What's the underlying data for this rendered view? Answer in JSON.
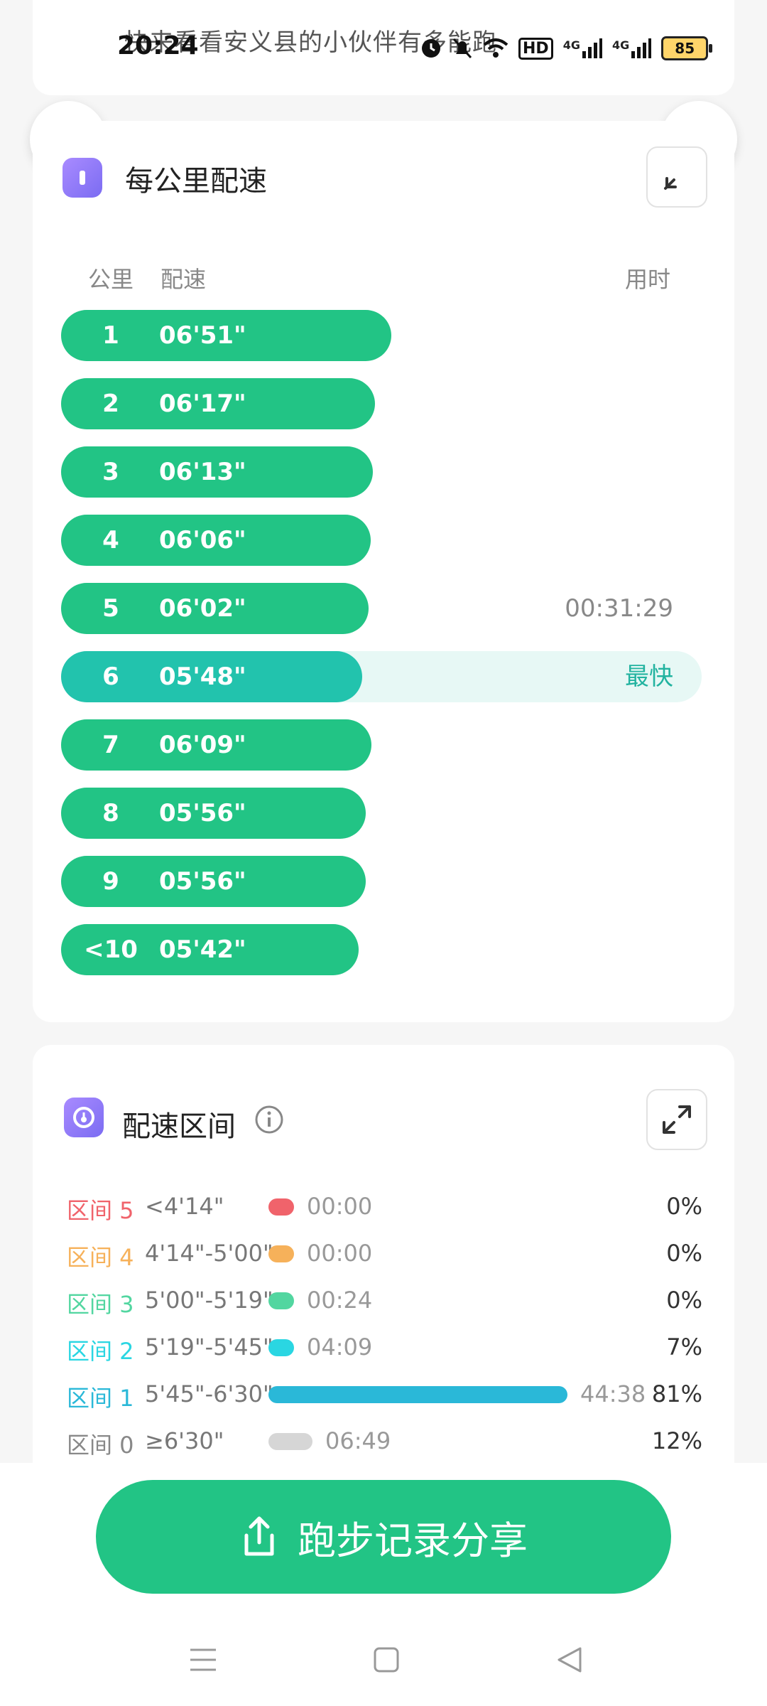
{
  "status_bar": {
    "title": "快来看看安义县的小伙伴有多能跑",
    "time": "20:24",
    "hd_label": "HD",
    "net1": "4G",
    "net2": "4G",
    "battery": "85"
  },
  "pace_card": {
    "title": "每公里配速",
    "col_km": "公里",
    "col_pace": "配速",
    "col_time": "用时",
    "rows": [
      {
        "km": "1",
        "pace": "06'51\"",
        "time": "",
        "fraction": 0.515,
        "fastest": false
      },
      {
        "km": "2",
        "pace": "06'17\"",
        "time": "",
        "fraction": 0.49,
        "fastest": false
      },
      {
        "km": "3",
        "pace": "06'13\"",
        "time": "",
        "fraction": 0.487,
        "fastest": false
      },
      {
        "km": "4",
        "pace": "06'06\"",
        "time": "",
        "fraction": 0.483,
        "fastest": false
      },
      {
        "km": "5",
        "pace": "06'02\"",
        "time": "00:31:29",
        "fraction": 0.48,
        "fastest": false
      },
      {
        "km": "6",
        "pace": "05'48\"",
        "time": "最快",
        "fraction": 0.47,
        "fastest": true
      },
      {
        "km": "7",
        "pace": "06'09\"",
        "time": "",
        "fraction": 0.485,
        "fastest": false
      },
      {
        "km": "8",
        "pace": "05'56\"",
        "time": "",
        "fraction": 0.476,
        "fastest": false
      },
      {
        "km": "9",
        "pace": "05'56\"",
        "time": "",
        "fraction": 0.476,
        "fastest": false
      },
      {
        "km": "<10",
        "pace": "05'42\"",
        "time": "",
        "fraction": 0.465,
        "fastest": false
      }
    ]
  },
  "zone_card": {
    "title": "配速区间",
    "zones": [
      {
        "label": "区间 5",
        "range": "<4'14\"",
        "time": "00:00",
        "percent": "0%",
        "fraction": 0.0,
        "color": "#f0636b"
      },
      {
        "label": "区间 4",
        "range": "4'14\"-5'00\"",
        "time": "00:00",
        "percent": "0%",
        "fraction": 0.0,
        "color": "#f6b15a"
      },
      {
        "label": "区间 3",
        "range": "5'00\"-5'19\"",
        "time": "00:24",
        "percent": "0%",
        "fraction": 0.005,
        "color": "#52d6a0"
      },
      {
        "label": "区间 2",
        "range": "5'19\"-5'45\"",
        "time": "04:09",
        "percent": "7%",
        "fraction": 0.07,
        "color": "#2ad6e2"
      },
      {
        "label": "区间 1",
        "range": "5'45\"-6'30\"",
        "time": "44:38",
        "percent": "81%",
        "fraction": 0.81,
        "color": "#2ab8d8"
      },
      {
        "label": "区间 0",
        "range": "≥6'30\"",
        "time": "06:49",
        "percent": "12%",
        "fraction": 0.12,
        "color": "#d6d6d6"
      }
    ]
  },
  "share_button": {
    "label": "跑步记录分享"
  },
  "colors": {
    "accent": "#22c485",
    "fastest": "#22c3ad"
  }
}
